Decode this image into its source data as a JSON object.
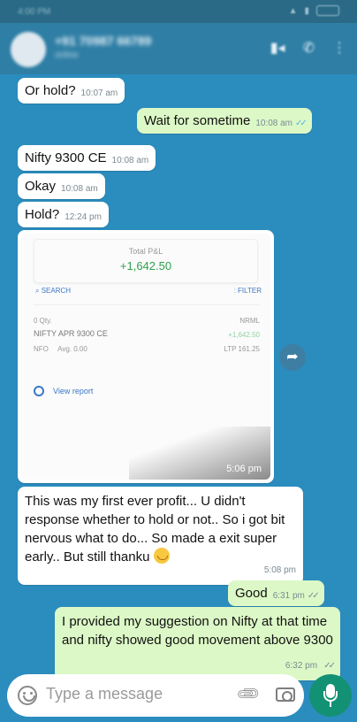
{
  "status": {
    "time": "4:00 PM"
  },
  "contact": {
    "name": "+91 70987 66789",
    "subtitle": "online"
  },
  "messages": [
    {
      "text": "Or hold?",
      "time": "10:07 am",
      "dir": "in"
    },
    {
      "text": "Wait for sometime",
      "time": "10:08 am",
      "dir": "out"
    },
    {
      "text": "Nifty 9300 CE",
      "time": "10:08 am",
      "dir": "in"
    },
    {
      "text": "Okay",
      "time": "10:08 am",
      "dir": "in"
    },
    {
      "text": "Hold?",
      "time": "12:24 pm",
      "dir": "in"
    },
    {
      "text": "This was my first ever profit... U didn't response whether to hold or not.. So i got bit nervous what to do...  So made a exit super early.. But still thanku",
      "time": "5:08 pm",
      "dir": "in"
    },
    {
      "text": "Good",
      "time": "6:31 pm",
      "dir": "out"
    },
    {
      "text": "I provided my suggestion on Nifty at that time and nifty showed good movement above 9300",
      "time": "6:32 pm",
      "dir": "out"
    }
  ],
  "image_message": {
    "time": "5:06 pm",
    "total_pnl_label": "Total P&L",
    "total_pnl_value": "+1,642.50",
    "search_label": "SEARCH",
    "filter_label": "FILTER",
    "qty": "0 Qty.",
    "product": "NRML",
    "instrument": "NIFTY APR 9300 CE",
    "position_pnl": "+1,642.50",
    "exchange": "NFO",
    "avg": "Avg. 0.00",
    "ltp": "LTP 161.25",
    "view_report": "View report"
  },
  "input": {
    "placeholder": "Type a message"
  },
  "icons": {
    "emoji": "emoji-icon",
    "attach": "paperclip-icon",
    "camera": "camera-icon",
    "mic": "mic-icon",
    "forward": "forward-icon",
    "video": "video-call-icon",
    "call": "phone-icon",
    "menu": "more-vert-icon"
  },
  "colors": {
    "chat_bg": "#2b8cbe",
    "incoming": "#ffffff",
    "outgoing": "#dcf8c6",
    "header": "#2f7ea5",
    "send_button": "#139174",
    "read_ticks": "#4fb6ec"
  }
}
